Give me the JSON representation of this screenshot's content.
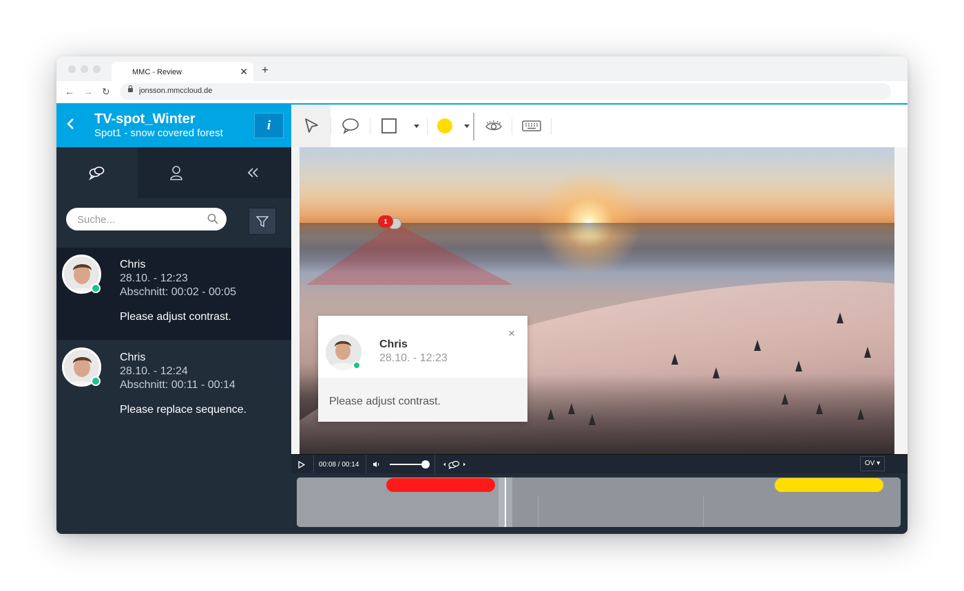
{
  "browser": {
    "tab_title": "MMC - Review",
    "tab_close": "✕",
    "new_tab": "+",
    "url": "jonsson.mmccloud.de",
    "nav": {
      "back": "←",
      "forward": "→",
      "reload": "↻"
    }
  },
  "header": {
    "back_glyph": "‹",
    "title": "TV-spot_Winter",
    "subtitle": "Spot1 - snow covered forest",
    "info_label": "i",
    "accent_color": "#00a5e3"
  },
  "sidebar": {
    "tabs": [
      {
        "icon": "comments-icon",
        "active": true
      },
      {
        "icon": "user-icon",
        "active": false
      },
      {
        "icon": "collapse-icon",
        "active": false
      }
    ],
    "search": {
      "placeholder": "Suche...",
      "value": ""
    },
    "comments": [
      {
        "author": "Chris",
        "date": "28.10. - 12:23",
        "range": "Abschnitt: 00:02 - 00:05",
        "text": "Please adjust contrast.",
        "selected": true,
        "online": true
      },
      {
        "author": "Chris",
        "date": "28.10. - 12:24",
        "range": "Abschnitt: 00:11 - 00:14",
        "text": "Please replace sequence.",
        "selected": false,
        "online": true
      }
    ]
  },
  "toolbar": {
    "tools": [
      "cursor-icon",
      "speech-bubble-icon",
      "rectangle-icon",
      "color-picker",
      "eye-icon",
      "keyboard-icon"
    ],
    "active_tool": "cursor-icon",
    "selected_color": "#ffdd00"
  },
  "video": {
    "marker_count": "1",
    "popup": {
      "author": "Chris",
      "date": "28.10. - 12:23",
      "text": "Please adjust contrast.",
      "close": "×"
    }
  },
  "player": {
    "time": "00:08 / 00:14",
    "volume": 0.9,
    "ov_label": "OV ▾",
    "position": 0.571
  },
  "timeline": {
    "segments": [
      {
        "start": "00:02",
        "end": "00:05",
        "color": "#ff1a1a"
      },
      {
        "start": "00:11",
        "end": "00:14",
        "color": "#ffdd00"
      }
    ]
  }
}
